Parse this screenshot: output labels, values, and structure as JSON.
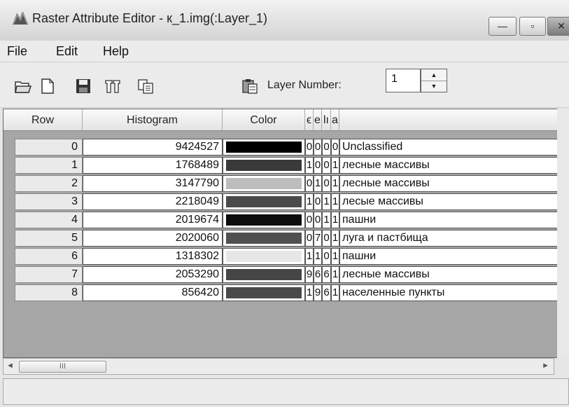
{
  "window": {
    "title": "Raster Attribute Editor - к_1.img(:Layer_1)",
    "controls": {
      "minimize": "—",
      "maximize": "▫",
      "close": "✕"
    }
  },
  "menu": [
    "File",
    "Edit",
    "Help"
  ],
  "toolbar": {
    "icons": [
      "open-folder-icon",
      "new-document-icon",
      "save-disk-icon",
      "columns-icon",
      "copy-icon",
      "paste-icon"
    ],
    "layer_label": "Layer Number:",
    "layer_value": "1"
  },
  "table": {
    "headers": [
      "Row",
      "Histogram",
      "Color",
      "ϵ",
      "e",
      "lı",
      "a",
      ""
    ],
    "rows": [
      {
        "row": "0",
        "histogram": "9424527",
        "color": "#000000",
        "c1": "0",
        "c2": "0",
        "c3": "0",
        "c4": "0",
        "name": "Unclassified"
      },
      {
        "row": "1",
        "histogram": "1768489",
        "color": "#3a3a3a",
        "c1": "1",
        "c2": "0",
        "c3": "0",
        "c4": "1",
        "name": "лесные массивы"
      },
      {
        "row": "2",
        "histogram": "3147790",
        "color": "#bdbdbd",
        "c1": "0",
        "c2": "1",
        "c3": "0",
        "c4": "1",
        "name": "лесные массивы"
      },
      {
        "row": "3",
        "histogram": "2218049",
        "color": "#4a4a4a",
        "c1": "1",
        "c2": "0",
        "c3": "1",
        "c4": "1",
        "name": "лесые массивы"
      },
      {
        "row": "4",
        "histogram": "2019674",
        "color": "#0d0d0d",
        "c1": "0",
        "c2": "0",
        "c3": "1",
        "c4": "1",
        "name": "пашни"
      },
      {
        "row": "5",
        "histogram": "2020060",
        "color": "#505050",
        "c1": "0",
        "c2": "7",
        "c3": "0",
        "c4": "1",
        "name": "луга и пастбища"
      },
      {
        "row": "6",
        "histogram": "1318302",
        "color": "#e6e6e6",
        "c1": "1",
        "c2": "1",
        "c3": "0",
        "c4": "1",
        "name": "пашни"
      },
      {
        "row": "7",
        "histogram": "2053290",
        "color": "#454545",
        "c1": "9",
        "c2": "6",
        "c3": "6",
        "c4": "1",
        "name": "лесные массивы"
      },
      {
        "row": "8",
        "histogram": "856420",
        "color": "#4a4a4a",
        "c1": "1",
        "c2": "9",
        "c3": "6",
        "c4": "1",
        "name": "населенные пункты"
      }
    ]
  },
  "scrollbar": {
    "left_arrow": "◄",
    "thumb": "III",
    "right_arrow": "►"
  }
}
